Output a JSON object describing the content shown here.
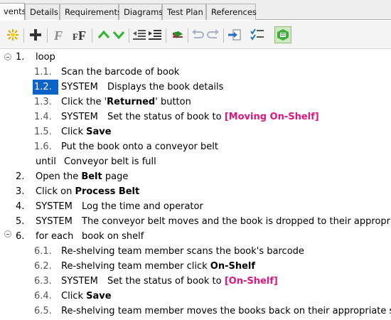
{
  "tabs": [
    "vents",
    "Details",
    "Requirements",
    "Diagrams",
    "Test Plan",
    "References"
  ],
  "toolbar": {
    "icons": [
      "sun-icon",
      "add-icon",
      "font-icon",
      "font-size-icon",
      "move-up-icon",
      "move-down-icon",
      "outdent-icon",
      "indent-icon",
      "flag-icon",
      "undo-icon",
      "redo-icon",
      "import-icon",
      "checklist-icon",
      "view-icon"
    ]
  },
  "flow": {
    "step1": {
      "num": "1.",
      "kw": "loop"
    },
    "step1_1": {
      "num": "1.1.",
      "text": "Scan the barcode of book"
    },
    "step1_2": {
      "num": "1.2.",
      "sys": "SYSTEM",
      "text": "Displays the book details"
    },
    "step1_3": {
      "num": "1.3.",
      "pre": "Click the '",
      "bold": "Returned",
      "post": "' button"
    },
    "step1_4": {
      "num": "1.4.",
      "sys": "SYSTEM",
      "pre": "Set the status of book to ",
      "mag": "[Moving On-Shelf]"
    },
    "step1_5": {
      "num": "1.5.",
      "pre": "Click ",
      "bold": "Save"
    },
    "step1_6": {
      "num": "1.6.",
      "text": "Put the book onto a conveyor belt"
    },
    "until": {
      "kw": "until",
      "text": "Conveyor belt is full"
    },
    "step2": {
      "num": "2.",
      "pre": "Open the ",
      "bold": "Belt",
      "post": " page"
    },
    "step3": {
      "num": "3.",
      "pre": "Click on ",
      "bold": "Process Belt"
    },
    "step4": {
      "num": "4.",
      "sys": "SYSTEM",
      "text": "Log the time and operator"
    },
    "step5": {
      "num": "5.",
      "sys": "SYSTEM",
      "text": "The conveyor belt moves and the book is dropped to their appropriate"
    },
    "step6": {
      "num": "6.",
      "kw": "for each",
      "text": "book on shelf"
    },
    "step6_1": {
      "num": "6.1.",
      "text": "Re-shelving team member scans the book's barcode"
    },
    "step6_2": {
      "num": "6.2.",
      "pre": "Re-shelving team member click ",
      "bold": "On-Shelf"
    },
    "step6_3": {
      "num": "6.3.",
      "sys": "SYSTEM",
      "pre": "Set the status of book to ",
      "mag": "[On-Shelf]"
    },
    "step6_4": {
      "num": "6.4.",
      "pre": "Click ",
      "bold": "Save"
    },
    "step6_5": {
      "num": "6.5.",
      "text": "Re-shelving team member moves the books back on their appropriate shelf"
    }
  },
  "colors": {
    "keyword": "#2aa02a",
    "system": "#c87814",
    "status": "#e0157d",
    "selection": "#0a64c8"
  }
}
